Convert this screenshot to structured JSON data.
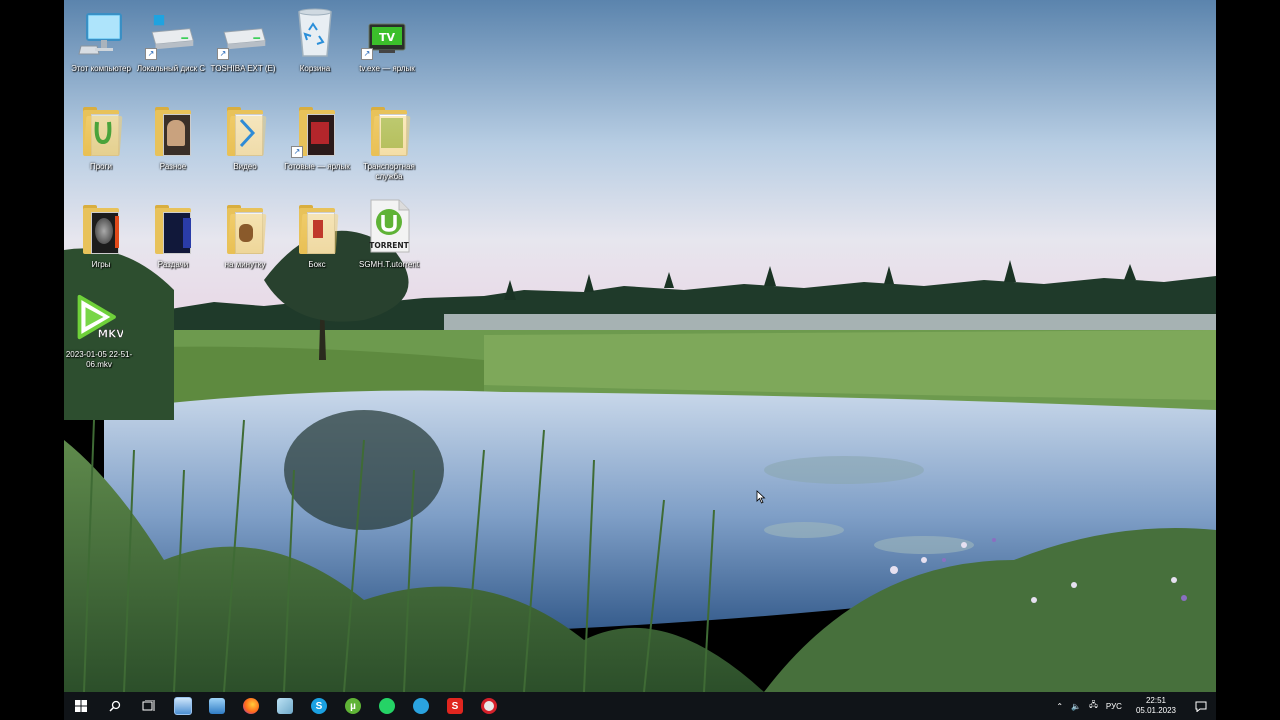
{
  "desktop": {
    "icons": [
      {
        "label": "Этот компьютер",
        "icon": "this-pc-icon"
      },
      {
        "label": "Локальный диск C",
        "icon": "drive-icon"
      },
      {
        "label": "TOSHIBA EXT (E)",
        "icon": "drive-icon"
      },
      {
        "label": "Корзина",
        "icon": "recycle-bin-icon"
      },
      {
        "label": "tv.exe — ярлык",
        "icon": "tv-icon"
      },
      {
        "label": "Проги",
        "icon": "folder-icon"
      },
      {
        "label": "Разное",
        "icon": "folder-icon"
      },
      {
        "label": "Видео",
        "icon": "folder-icon"
      },
      {
        "label": "Готовые — ярлык",
        "icon": "folder-icon"
      },
      {
        "label": "Транспортная служба",
        "icon": "folder-icon"
      },
      {
        "label": "Игры",
        "icon": "folder-icon"
      },
      {
        "label": "Раздачи",
        "icon": "folder-icon"
      },
      {
        "label": "на минутку",
        "icon": "folder-icon"
      },
      {
        "label": "Бокс",
        "icon": "folder-icon"
      },
      {
        "label": "SGMH.T.utorrent",
        "icon": "torrent-file-icon"
      },
      {
        "label": "2023-01-05 22-51-06.mkv",
        "icon": "mkv-file-icon"
      }
    ],
    "torrent_badge": "TORRENT",
    "tv_badge": "TV",
    "mkv_badge": "MKV"
  },
  "taskbar": {
    "apps": [
      "start",
      "search",
      "task-view",
      "explorer",
      "monitor",
      "firefox",
      "notepad",
      "skype",
      "utorrent",
      "whatsapp",
      "telegram",
      "adobe",
      "opera"
    ],
    "tray": {
      "language": "РУС",
      "time": "22:51",
      "date": "05.01.2023"
    }
  }
}
